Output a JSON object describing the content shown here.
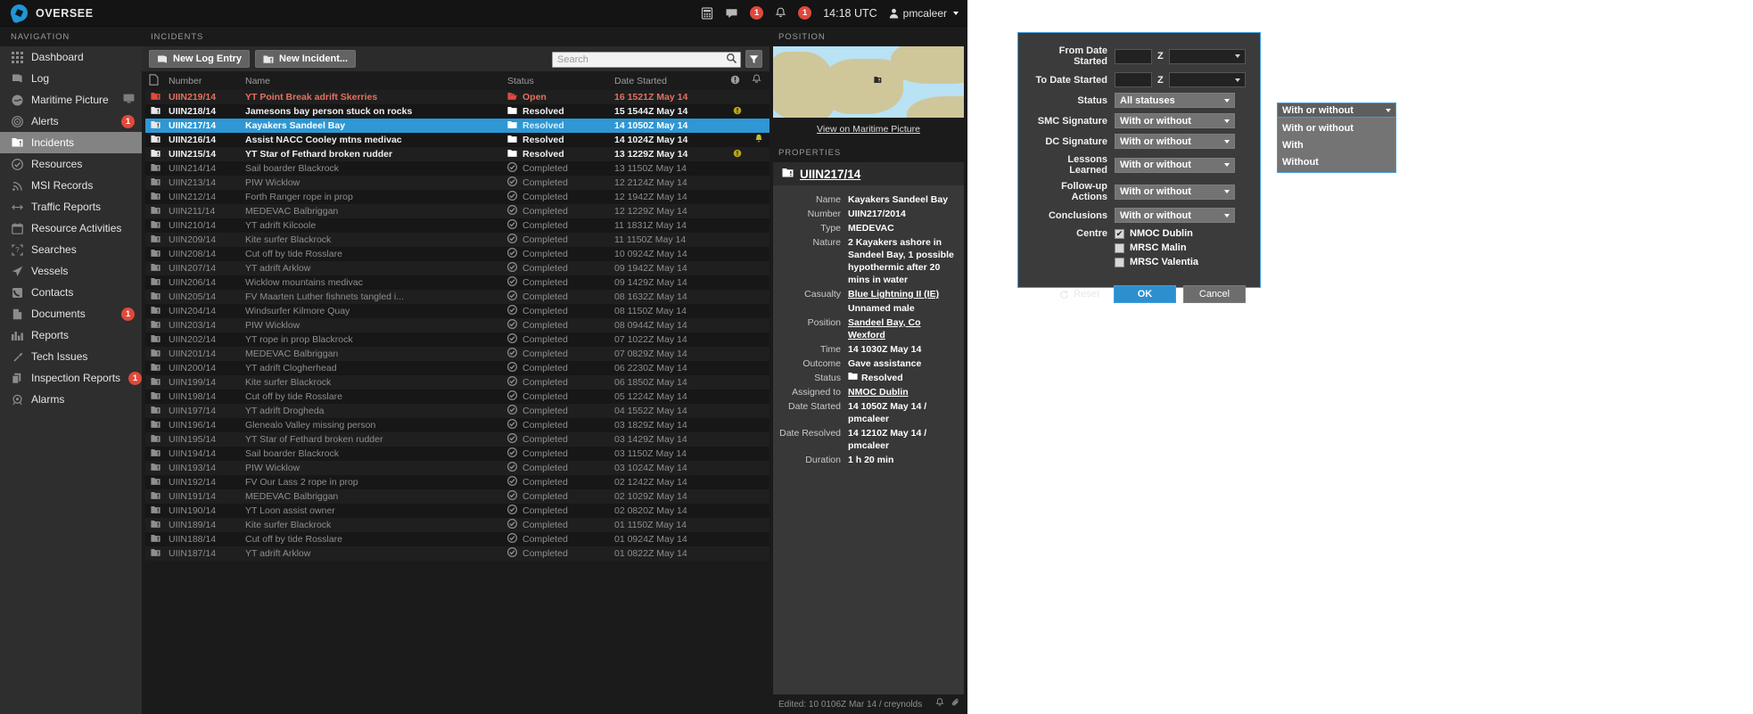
{
  "topbar": {
    "brand": "OVERSEE",
    "icons": [
      {
        "name": "calculator-icon"
      },
      {
        "name": "chat-icon",
        "badge": "1"
      },
      {
        "name": "bell-icon",
        "badge": "1"
      }
    ],
    "clock": "14:18 UTC",
    "user": "pmcaleer"
  },
  "sidebar": {
    "header": "NAVIGATION",
    "items": [
      {
        "label": "Dashboard",
        "icon": "grid-icon",
        "active": false
      },
      {
        "label": "Log",
        "icon": "book-icon",
        "active": false
      },
      {
        "label": "Maritime Picture",
        "icon": "globe-icon",
        "active": false,
        "monitor": true
      },
      {
        "label": "Alerts",
        "icon": "target-icon",
        "active": false,
        "badge": "1"
      },
      {
        "label": "Incidents",
        "icon": "incident-icon",
        "active": true
      },
      {
        "label": "Resources",
        "icon": "check-circle-icon",
        "active": false
      },
      {
        "label": "MSI Records",
        "icon": "rss-icon",
        "active": false
      },
      {
        "label": "Traffic Reports",
        "icon": "arrows-icon",
        "active": false
      },
      {
        "label": "Resource Activities",
        "icon": "calendar-icon",
        "active": false
      },
      {
        "label": "Searches",
        "icon": "search-area-icon",
        "active": false
      },
      {
        "label": "Vessels",
        "icon": "vessel-icon",
        "active": false
      },
      {
        "label": "Contacts",
        "icon": "phone-icon",
        "active": false
      },
      {
        "label": "Documents",
        "icon": "document-icon",
        "active": false,
        "badge": "1"
      },
      {
        "label": "Reports",
        "icon": "bar-chart-icon",
        "active": false
      },
      {
        "label": "Tech Issues",
        "icon": "wrench-icon",
        "active": false
      },
      {
        "label": "Inspection Reports",
        "icon": "copy-icon",
        "active": false,
        "badge": "1"
      },
      {
        "label": "Alarms",
        "icon": "alarm-icon",
        "active": false
      }
    ]
  },
  "incidents": {
    "header": "INCIDENTS",
    "toolbar": {
      "new_log_entry": "New Log Entry",
      "new_incident": "New Incident...",
      "search_placeholder": "Search",
      "search_value": ""
    },
    "columns": [
      "",
      "Number",
      "Name",
      "Status",
      "Date Started",
      "",
      ""
    ],
    "rows": [
      {
        "number": "UIIN219/14",
        "name": "YT Point Break adrift Skerries",
        "status": "Open",
        "date": "16 1521Z May 14",
        "state": "open",
        "info": false,
        "bell": false,
        "selected": false
      },
      {
        "number": "UIIN218/14",
        "name": "Jamesons bay person stuck on rocks",
        "status": "Resolved",
        "date": "15 1544Z May 14",
        "state": "resolved",
        "info": true,
        "bell": false,
        "selected": false
      },
      {
        "number": "UIIN217/14",
        "name": "Kayakers Sandeel Bay",
        "status": "Resolved",
        "date": "14 1050Z May 14",
        "state": "resolved",
        "info": false,
        "bell": false,
        "selected": true
      },
      {
        "number": "UIIN216/14",
        "name": "Assist NACC Cooley mtns medivac",
        "status": "Resolved",
        "date": "14 1024Z May 14",
        "state": "resolved",
        "info": false,
        "bell": true,
        "selected": false
      },
      {
        "number": "UIIN215/14",
        "name": "YT Star of Fethard broken rudder",
        "status": "Resolved",
        "date": "13 1229Z May 14",
        "state": "resolved",
        "info": true,
        "bell": false,
        "selected": false
      },
      {
        "number": "UIIN214/14",
        "name": "Sail boarder Blackrock",
        "status": "Completed",
        "date": "13 1150Z May 14",
        "state": "completed",
        "info": false,
        "bell": false,
        "selected": false
      },
      {
        "number": "UIIN213/14",
        "name": "PIW Wicklow",
        "status": "Completed",
        "date": "12 2124Z May 14",
        "state": "completed",
        "info": false,
        "bell": false,
        "selected": false
      },
      {
        "number": "UIIN212/14",
        "name": "Forth Ranger rope in prop",
        "status": "Completed",
        "date": "12 1942Z May 14",
        "state": "completed",
        "info": false,
        "bell": false,
        "selected": false
      },
      {
        "number": "UIIN211/14",
        "name": "MEDEVAC Balbriggan",
        "status": "Completed",
        "date": "12 1229Z May 14",
        "state": "completed",
        "info": false,
        "bell": false,
        "selected": false
      },
      {
        "number": "UIIN210/14",
        "name": "YT adrift Kilcoole",
        "status": "Completed",
        "date": "11 1831Z May 14",
        "state": "completed",
        "info": false,
        "bell": false,
        "selected": false
      },
      {
        "number": "UIIN209/14",
        "name": "Kite surfer Blackrock",
        "status": "Completed",
        "date": "11 1150Z May 14",
        "state": "completed",
        "info": false,
        "bell": false,
        "selected": false
      },
      {
        "number": "UIIN208/14",
        "name": "Cut off by tide Rosslare",
        "status": "Completed",
        "date": "10 0924Z May 14",
        "state": "completed",
        "info": false,
        "bell": false,
        "selected": false
      },
      {
        "number": "UIIN207/14",
        "name": "YT adrift Arklow",
        "status": "Completed",
        "date": "09 1942Z May 14",
        "state": "completed",
        "info": false,
        "bell": false,
        "selected": false
      },
      {
        "number": "UIIN206/14",
        "name": "Wicklow mountains medivac",
        "status": "Completed",
        "date": "09 1429Z May 14",
        "state": "completed",
        "info": false,
        "bell": false,
        "selected": false
      },
      {
        "number": "UIIN205/14",
        "name": "FV Maarten Luther fishnets tangled i...",
        "status": "Completed",
        "date": "08 1632Z May 14",
        "state": "completed",
        "info": false,
        "bell": false,
        "selected": false
      },
      {
        "number": "UIIN204/14",
        "name": "Windsurfer Kilmore Quay",
        "status": "Completed",
        "date": "08 1150Z May 14",
        "state": "completed",
        "info": false,
        "bell": false,
        "selected": false
      },
      {
        "number": "UIIN203/14",
        "name": "PIW Wicklow",
        "status": "Completed",
        "date": "08 0944Z May 14",
        "state": "completed",
        "info": false,
        "bell": false,
        "selected": false
      },
      {
        "number": "UIIN202/14",
        "name": "YT rope in prop Blackrock",
        "status": "Completed",
        "date": "07 1022Z May 14",
        "state": "completed",
        "info": false,
        "bell": false,
        "selected": false
      },
      {
        "number": "UIIN201/14",
        "name": "MEDEVAC Balbriggan",
        "status": "Completed",
        "date": "07 0829Z May 14",
        "state": "completed",
        "info": false,
        "bell": false,
        "selected": false
      },
      {
        "number": "UIIN200/14",
        "name": "YT adrift Clogherhead",
        "status": "Completed",
        "date": "06 2230Z May 14",
        "state": "completed",
        "info": false,
        "bell": false,
        "selected": false
      },
      {
        "number": "UIIN199/14",
        "name": "Kite surfer Blackrock",
        "status": "Completed",
        "date": "06 1850Z May 14",
        "state": "completed",
        "info": false,
        "bell": false,
        "selected": false
      },
      {
        "number": "UIIN198/14",
        "name": "Cut off by tide Rosslare",
        "status": "Completed",
        "date": "05 1224Z May 14",
        "state": "completed",
        "info": false,
        "bell": false,
        "selected": false
      },
      {
        "number": "UIIN197/14",
        "name": "YT adrift Drogheda",
        "status": "Completed",
        "date": "04 1552Z May 14",
        "state": "completed",
        "info": false,
        "bell": false,
        "selected": false
      },
      {
        "number": "UIIN196/14",
        "name": "Glenealo Valley missing person",
        "status": "Completed",
        "date": "03 1829Z May 14",
        "state": "completed",
        "info": false,
        "bell": false,
        "selected": false
      },
      {
        "number": "UIIN195/14",
        "name": "YT Star of Fethard broken rudder",
        "status": "Completed",
        "date": "03 1429Z May 14",
        "state": "completed",
        "info": false,
        "bell": false,
        "selected": false
      },
      {
        "number": "UIIN194/14",
        "name": "Sail boarder Blackrock",
        "status": "Completed",
        "date": "03 1150Z May 14",
        "state": "completed",
        "info": false,
        "bell": false,
        "selected": false
      },
      {
        "number": "UIIN193/14",
        "name": "PIW Wicklow",
        "status": "Completed",
        "date": "03 1024Z May 14",
        "state": "completed",
        "info": false,
        "bell": false,
        "selected": false
      },
      {
        "number": "UIIN192/14",
        "name": "FV Our Lass 2 rope in prop",
        "status": "Completed",
        "date": "02 1242Z May 14",
        "state": "completed",
        "info": false,
        "bell": false,
        "selected": false
      },
      {
        "number": "UIIN191/14",
        "name": "MEDEVAC Balbriggan",
        "status": "Completed",
        "date": "02 1029Z May 14",
        "state": "completed",
        "info": false,
        "bell": false,
        "selected": false
      },
      {
        "number": "UIIN190/14",
        "name": "YT Loon assist owner",
        "status": "Completed",
        "date": "02 0820Z May 14",
        "state": "completed",
        "info": false,
        "bell": false,
        "selected": false
      },
      {
        "number": "UIIN189/14",
        "name": "Kite surfer Blackrock",
        "status": "Completed",
        "date": "01 1150Z May 14",
        "state": "completed",
        "info": false,
        "bell": false,
        "selected": false
      },
      {
        "number": "UIIN188/14",
        "name": "Cut off by tide Rosslare",
        "status": "Completed",
        "date": "01 0924Z May 14",
        "state": "completed",
        "info": false,
        "bell": false,
        "selected": false
      },
      {
        "number": "UIIN187/14",
        "name": "YT adrift Arklow",
        "status": "Completed",
        "date": "01 0822Z May 14",
        "state": "completed",
        "info": false,
        "bell": false,
        "selected": false
      }
    ]
  },
  "position": {
    "header": "POSITION",
    "link": "View on Maritime Picture"
  },
  "properties": {
    "header": "PROPERTIES",
    "title": "UIIN217/14",
    "fields": [
      {
        "key": "Name",
        "value": "Kayakers Sandeel Bay",
        "link": false
      },
      {
        "key": "Number",
        "value": "UIIN217/2014",
        "link": false
      },
      {
        "key": "Type",
        "value": "MEDEVAC",
        "link": false
      },
      {
        "key": "Nature",
        "value": "2 Kayakers ashore in Sandeel Bay, 1 possible hypothermic after 20 mins in water",
        "link": false
      },
      {
        "key": "Casualty",
        "value": "Blue Lightning II (IE)",
        "link": true
      },
      {
        "key": "",
        "value": "Unnamed male",
        "link": false
      },
      {
        "key": "Position",
        "value": "Sandeel Bay, Co Wexford",
        "link": true
      },
      {
        "key": "Time",
        "value": "14 1030Z May 14",
        "link": false
      },
      {
        "key": "Outcome",
        "value": "Gave assistance",
        "link": false
      },
      {
        "key": "Status",
        "value": "Resolved",
        "link": false,
        "folder": true
      },
      {
        "key": "Assigned to",
        "value": "NMOC Dublin",
        "link": true
      },
      {
        "key": "Date Started",
        "value": "14 1050Z May 14 / pmcaleer",
        "link": false
      },
      {
        "key": "Date Resolved",
        "value": "14 1210Z May 14 / pmcaleer",
        "link": false
      },
      {
        "key": "Duration",
        "value": "1 h 20 min",
        "link": false
      }
    ],
    "footer": "Edited: 10 0106Z Mar 14 / creynolds"
  },
  "filter_dialog": {
    "rows": [
      {
        "label": "From Date Started",
        "type": "date",
        "value": "",
        "z": "Z",
        "select_value": ""
      },
      {
        "label": "To Date Started",
        "type": "date",
        "value": "",
        "z": "Z",
        "select_value": ""
      },
      {
        "label": "Status",
        "type": "select",
        "value": "All statuses"
      },
      {
        "label": "SMC Signature",
        "type": "select",
        "value": "With or without"
      },
      {
        "label": "DC Signature",
        "type": "select",
        "value": "With or without"
      },
      {
        "label": "Lessons  Learned",
        "type": "select",
        "value": "With or without"
      },
      {
        "label": "Follow-up Actions",
        "type": "select",
        "value": "With or without"
      },
      {
        "label": "Conclusions",
        "type": "select",
        "value": "With or without"
      }
    ],
    "centre_label": "Centre",
    "centres": [
      {
        "label": "NMOC Dublin",
        "checked": true
      },
      {
        "label": "MRSC Malin",
        "checked": false
      },
      {
        "label": "MRSC Valentia",
        "checked": false
      }
    ],
    "reset": "Reset",
    "ok": "OK",
    "cancel": "Cancel"
  },
  "dropdown": {
    "selected": "With or without",
    "options": [
      "With or without",
      "With",
      "Without"
    ]
  }
}
